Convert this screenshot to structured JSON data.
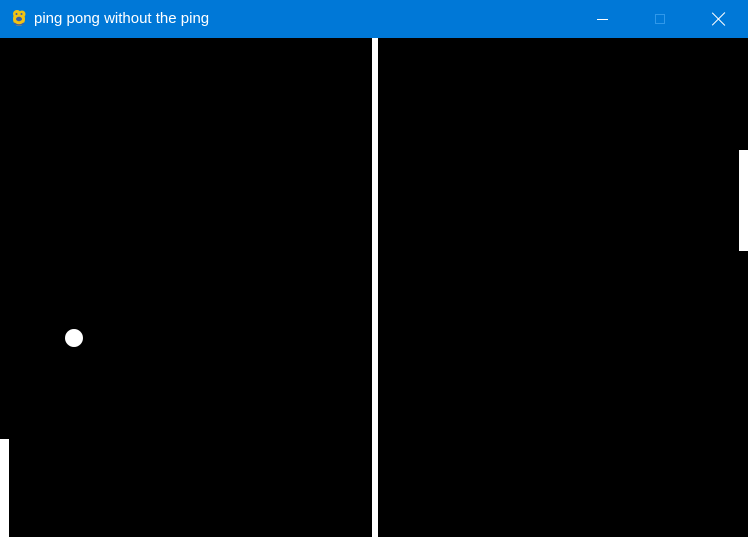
{
  "window": {
    "title": "ping pong without the ping",
    "icon": "pygame-snake-icon",
    "controls": {
      "minimize": "minimize-icon",
      "maximize": "maximize-icon",
      "close": "close-icon"
    },
    "colors": {
      "titlebar": "#0078d7",
      "titlebar_text": "#ffffff"
    }
  },
  "game": {
    "background": "#000000",
    "foreground": "#ffffff",
    "elements": [
      "center-line",
      "left-paddle",
      "right-paddle",
      "ball"
    ]
  }
}
